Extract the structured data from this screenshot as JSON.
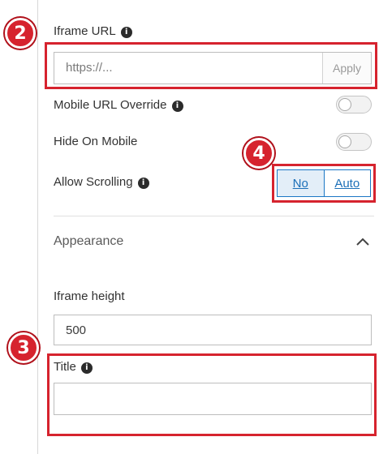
{
  "iframe_url": {
    "label": "Iframe URL",
    "placeholder": "https://...",
    "apply_label": "Apply"
  },
  "mobile_url_override": {
    "label": "Mobile URL Override",
    "enabled": false
  },
  "hide_on_mobile": {
    "label": "Hide On Mobile",
    "enabled": false
  },
  "allow_scrolling": {
    "label": "Allow Scrolling",
    "options": [
      "No",
      "Auto"
    ],
    "selected": "No"
  },
  "appearance": {
    "label": "Appearance",
    "expanded": true
  },
  "iframe_height": {
    "label": "Iframe height",
    "value": "500"
  },
  "title_field": {
    "label": "Title",
    "value": ""
  },
  "info_glyph": "i",
  "annotations": {
    "badge_2": "2",
    "badge_3": "3",
    "badge_4": "4"
  },
  "colors": {
    "annotation_red": "#d6232e",
    "accent_blue": "#1b77c5"
  }
}
